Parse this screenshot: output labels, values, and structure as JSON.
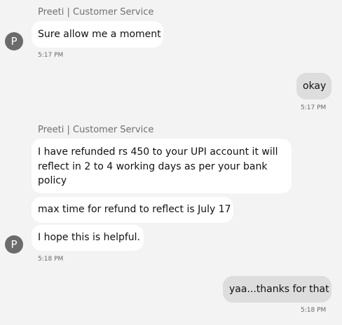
{
  "conversation": {
    "group1": {
      "sender": "Preeti | Customer Service",
      "avatar_initial": "P",
      "messages": [
        "Sure allow me a moment"
      ],
      "time": "5:17 PM"
    },
    "reply1": {
      "message": "okay",
      "time": "5:17 PM"
    },
    "group2": {
      "sender": "Preeti | Customer Service",
      "avatar_initial": "P",
      "messages": [
        "I have refunded rs 450 to your UPI account it will reflect in 2 to 4 working days as per your bank policy",
        "max time for refund to reflect is July 17",
        "I hope this is helpful."
      ],
      "time": "5:18 PM"
    },
    "reply2": {
      "message": "yaa...thanks for that",
      "time": "5:18 PM"
    }
  }
}
